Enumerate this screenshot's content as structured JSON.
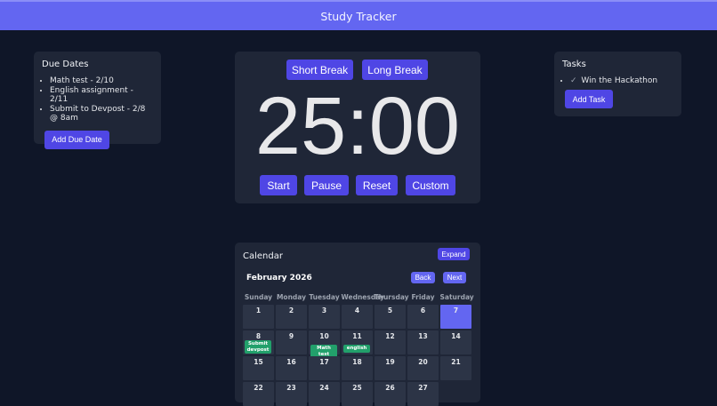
{
  "header": {
    "title": "Study Tracker"
  },
  "due_dates": {
    "title": "Due Dates",
    "items": [
      "Math test - 2/10",
      "English assignment - 2/11",
      "Submit to Devpost - 2/8 @ 8am"
    ],
    "add_label": "Add Due Date"
  },
  "timer": {
    "short_break_label": "Short Break",
    "long_break_label": "Long Break",
    "time": "25:00",
    "start_label": "Start",
    "pause_label": "Pause",
    "reset_label": "Reset",
    "custom_label": "Custom"
  },
  "tasks": {
    "title": "Tasks",
    "items": [
      {
        "check": "✓",
        "label": "Win the Hackathon"
      }
    ],
    "add_label": "Add Task"
  },
  "calendar": {
    "title": "Calendar",
    "expand_label": "Expand",
    "month_label": "February 2026",
    "back_label": "Back",
    "next_label": "Next",
    "weekdays": [
      "Sunday",
      "Monday",
      "Tuesday",
      "Wednesday",
      "Thursday",
      "Friday",
      "Saturday"
    ],
    "days": [
      "1",
      "2",
      "3",
      "4",
      "5",
      "6",
      "7",
      "8",
      "9",
      "10",
      "11",
      "12",
      "13",
      "14",
      "15",
      "16",
      "17",
      "18",
      "19",
      "20",
      "21",
      "22",
      "23",
      "24",
      "25",
      "26",
      "27"
    ],
    "today": "7",
    "events": [
      {
        "day": "8",
        "label": "Submit devpost"
      },
      {
        "day": "10",
        "label": "Math test"
      },
      {
        "day": "11",
        "label": "english"
      }
    ]
  },
  "colors": {
    "header_bg": "#6366f1",
    "page_bg": "#0f1628",
    "card_bg": "#1f2637",
    "button_bg": "#4f46e5",
    "event_bg": "#22a06b",
    "today_bg": "#6366f1"
  }
}
